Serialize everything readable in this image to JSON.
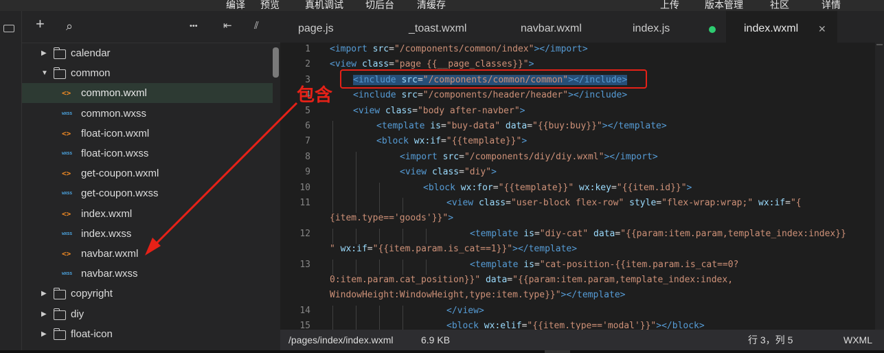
{
  "menu": [
    "编译",
    "预览",
    "真机调试",
    "切后台",
    "清缓存",
    "上传",
    "版本管理",
    "社区",
    "详情"
  ],
  "sidebar_toolbar": {
    "add": "+",
    "search": "⌕",
    "more": "•••",
    "collapse": "⇤",
    "split": "⫽"
  },
  "tree": [
    {
      "type": "folder",
      "label": "calendar",
      "open": false
    },
    {
      "type": "folder",
      "label": "common",
      "open": true
    },
    {
      "type": "wxml",
      "label": "common.wxml",
      "selected": true
    },
    {
      "type": "wxss",
      "label": "common.wxss"
    },
    {
      "type": "wxml",
      "label": "float-icon.wxml"
    },
    {
      "type": "wxss",
      "label": "float-icon.wxss"
    },
    {
      "type": "wxml",
      "label": "get-coupon.wxml"
    },
    {
      "type": "wxss",
      "label": "get-coupon.wxss"
    },
    {
      "type": "wxml",
      "label": "index.wxml"
    },
    {
      "type": "wxss",
      "label": "index.wxss"
    },
    {
      "type": "wxml",
      "label": "navbar.wxml"
    },
    {
      "type": "wxss",
      "label": "navbar.wxss"
    },
    {
      "type": "folder",
      "label": "copyright",
      "open": false
    },
    {
      "type": "folder",
      "label": "diy",
      "open": false
    },
    {
      "type": "folder",
      "label": "float-icon",
      "open": false
    }
  ],
  "icons": {
    "wxml": "<>",
    "wxss": "wxss"
  },
  "tabs": [
    "page.js",
    "_toast.wxml",
    "navbar.wxml",
    "index.js",
    "index.wxml"
  ],
  "tab_close": "✕",
  "annotation": "包含",
  "line_numbers": [
    "1",
    "2",
    "3",
    "4",
    "5",
    "6",
    "7",
    "8",
    "9",
    "10",
    "11",
    "",
    "12",
    "",
    "13",
    "",
    "",
    "14",
    "15"
  ],
  "code_lines": [
    [
      [
        "t",
        "<import "
      ],
      [
        "a",
        "src"
      ],
      [
        "e",
        "="
      ],
      [
        "s",
        "\"/components/common/index\""
      ],
      [
        "t",
        "></import>"
      ]
    ],
    [
      [
        "t",
        "<view "
      ],
      [
        "a",
        "class"
      ],
      [
        "e",
        "="
      ],
      [
        "s",
        "\"page {{__page_classes}}\""
      ],
      [
        "t",
        ">"
      ]
    ],
    [
      [
        "t",
        "<include "
      ],
      [
        "a",
        "src"
      ],
      [
        "e",
        "="
      ],
      [
        "s",
        "\"/components/common/common\""
      ],
      [
        "t",
        "></include>"
      ]
    ],
    [
      [
        "t",
        "<include "
      ],
      [
        "a",
        "src"
      ],
      [
        "e",
        "="
      ],
      [
        "s",
        "\"/components/header/header\""
      ],
      [
        "t",
        "></include>"
      ]
    ],
    [
      [
        "t",
        "<view "
      ],
      [
        "a",
        "class"
      ],
      [
        "e",
        "="
      ],
      [
        "s",
        "\"body after-navber\""
      ],
      [
        "t",
        ">"
      ]
    ],
    [
      [
        "t",
        "<template "
      ],
      [
        "a",
        "is"
      ],
      [
        "e",
        "="
      ],
      [
        "s",
        "\"buy-data\""
      ],
      [
        "e",
        " "
      ],
      [
        "a",
        "data"
      ],
      [
        "e",
        "="
      ],
      [
        "s",
        "\"{{buy:buy}}\""
      ],
      [
        "t",
        "></template>"
      ]
    ],
    [
      [
        "t",
        "<block "
      ],
      [
        "a",
        "wx:if"
      ],
      [
        "e",
        "="
      ],
      [
        "s",
        "\"{{template}}\""
      ],
      [
        "t",
        ">"
      ]
    ],
    [
      [
        "t",
        "<import "
      ],
      [
        "a",
        "src"
      ],
      [
        "e",
        "="
      ],
      [
        "s",
        "\"/components/diy/diy.wxml\""
      ],
      [
        "t",
        "></import>"
      ]
    ],
    [
      [
        "t",
        "<view "
      ],
      [
        "a",
        "class"
      ],
      [
        "e",
        "="
      ],
      [
        "s",
        "\"diy\""
      ],
      [
        "t",
        ">"
      ]
    ],
    [
      [
        "t",
        "<block "
      ],
      [
        "a",
        "wx:for"
      ],
      [
        "e",
        "="
      ],
      [
        "s",
        "\"{{template}}\""
      ],
      [
        "e",
        " "
      ],
      [
        "a",
        "wx:key"
      ],
      [
        "e",
        "="
      ],
      [
        "s",
        "\"{{item.id}}\""
      ],
      [
        "t",
        ">"
      ]
    ],
    [
      [
        "t",
        "<view "
      ],
      [
        "a",
        "class"
      ],
      [
        "e",
        "="
      ],
      [
        "s",
        "\"user-block flex-row\""
      ],
      [
        "e",
        " "
      ],
      [
        "a",
        "style"
      ],
      [
        "e",
        "="
      ],
      [
        "s",
        "\"flex-wrap:wrap;\""
      ],
      [
        "e",
        " "
      ],
      [
        "a",
        "wx:if"
      ],
      [
        "e",
        "="
      ],
      [
        "s",
        "\"{"
      ]
    ],
    [
      [
        "s",
        "{item.type=='goods'}}\""
      ],
      [
        "t",
        ">"
      ]
    ],
    [
      [
        "t",
        "<template "
      ],
      [
        "a",
        "is"
      ],
      [
        "e",
        "="
      ],
      [
        "s",
        "\"diy-cat\""
      ],
      [
        "e",
        " "
      ],
      [
        "a",
        "data"
      ],
      [
        "e",
        "="
      ],
      [
        "s",
        "\"{{param:item.param,template_index:index}}"
      ]
    ],
    [
      [
        "s",
        "\""
      ],
      [
        "e",
        " "
      ],
      [
        "a",
        "wx:if"
      ],
      [
        "e",
        "="
      ],
      [
        "s",
        "\"{{item.param.is_cat==1}}\""
      ],
      [
        "t",
        "></template>"
      ]
    ],
    [
      [
        "t",
        "<template "
      ],
      [
        "a",
        "is"
      ],
      [
        "e",
        "="
      ],
      [
        "s",
        "\"cat-position-{{item.param.is_cat==0?"
      ]
    ],
    [
      [
        "s",
        "0:item.param.cat_position}}\""
      ],
      [
        "e",
        " "
      ],
      [
        "a",
        "data"
      ],
      [
        "e",
        "="
      ],
      [
        "s",
        "\"{{param:item.param,template_index:index,"
      ]
    ],
    [
      [
        "s",
        "WindowHeight:WindowHeight,type:item.type}}\""
      ],
      [
        "t",
        "></template>"
      ]
    ],
    [
      [
        "t",
        "</view>"
      ]
    ],
    [
      [
        "t",
        "<block "
      ],
      [
        "a",
        "wx:elif"
      ],
      [
        "e",
        "="
      ],
      [
        "s",
        "\"{{item.type=='modal'}}\""
      ],
      [
        "t",
        "></block>"
      ]
    ]
  ],
  "status": {
    "path": "/pages/index/index.wxml",
    "size": "6.9 KB",
    "position": "行 3，列 5",
    "lang": "WXML"
  }
}
